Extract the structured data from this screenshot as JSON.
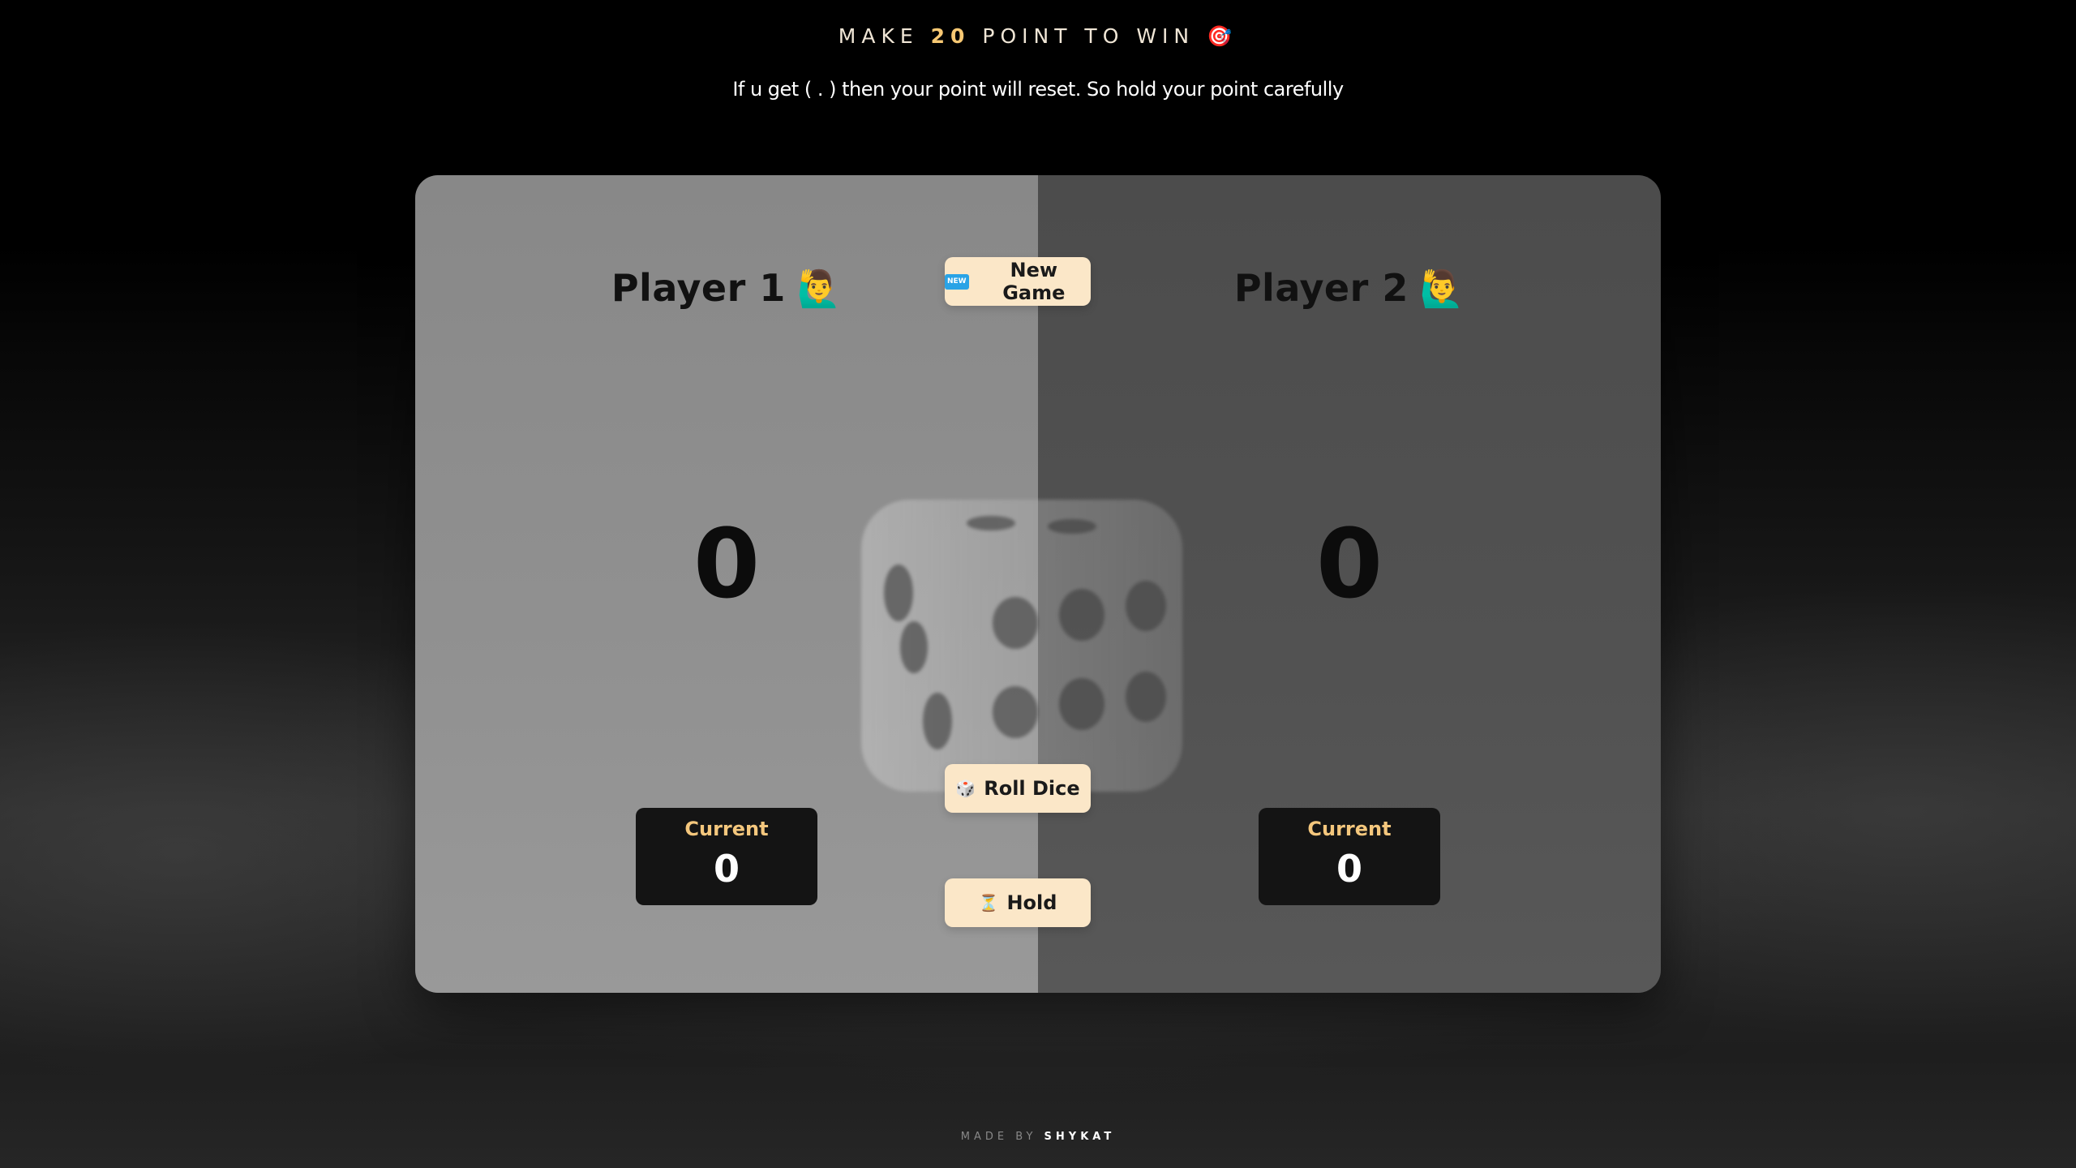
{
  "header": {
    "title_prefix": "MAKE",
    "target_points": "20",
    "title_suffix": "POINT TO WIN",
    "title_emoji": "🎯",
    "subtitle": "If u get ( . ) then your point will reset. So hold your point carefully"
  },
  "players": [
    {
      "name": "Player 1",
      "emoji": "🙋‍♂️",
      "score": "0",
      "current_label": "Current",
      "current_value": "0",
      "active": true
    },
    {
      "name": "Player 2",
      "emoji": "🙋‍♂️",
      "score": "0",
      "current_label": "Current",
      "current_value": "0",
      "active": false
    }
  ],
  "controls": {
    "new_game_icon": "NEW",
    "new_game_label": "New Game",
    "roll_icon": "🎲",
    "roll_label": "Roll Dice",
    "hold_icon": "⏳",
    "hold_label": "Hold"
  },
  "footer": {
    "made_by_label": "MADE BY",
    "author": "SHYKAT"
  },
  "colors": {
    "accent": "#f7c873",
    "button_bg": "#fbe7c8",
    "active_panel": "#8a8a8a",
    "inactive_panel": "#4c4c4c",
    "current_box": "#141414"
  }
}
